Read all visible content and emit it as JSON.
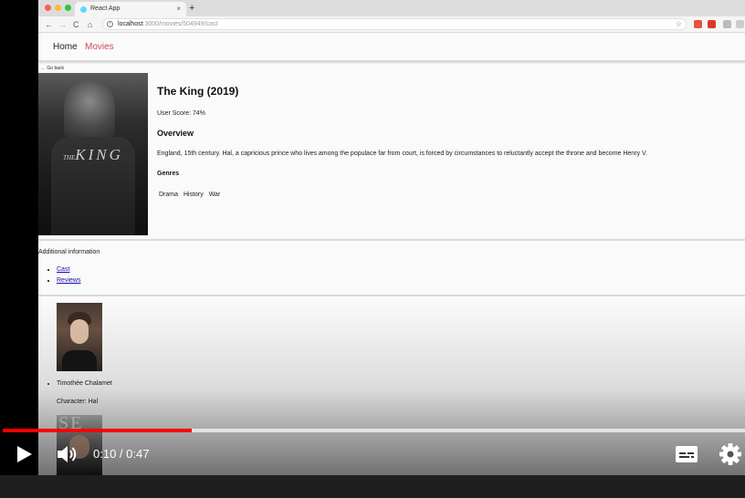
{
  "browser": {
    "tab_title": "React App",
    "tab_close": "×",
    "new_tab": "+",
    "url_host": "localhost",
    "url_path": ":3000/movies/504949/cast",
    "back": "←",
    "forward": "→",
    "reload": "C",
    "home": "⌂",
    "star": "☆",
    "info": "i"
  },
  "site_nav": {
    "home": "Home",
    "movies": "Movies"
  },
  "go_back": "← Go back",
  "movie": {
    "poster_the": "THE",
    "poster_title": "KING",
    "title": "The King (2019)",
    "user_score": "User Score: 74%",
    "overview_heading": "Overview",
    "overview_text": "England, 15th century. Hal, a capricious prince who lives among the populace far from court, is forced by circumstances to reluctantly accept the throne and become Henry V.",
    "genres_heading": "Genres",
    "genres": [
      "Drama",
      "History",
      "War"
    ]
  },
  "additional": {
    "heading": "Additional information",
    "links": [
      "Cast",
      "Reviews"
    ]
  },
  "cast": [
    {
      "name": "Timothée Chalamet",
      "character": "Character: Hal"
    }
  ],
  "cast_photo_2_text": "SE",
  "player": {
    "time": "0:10 / 0:47",
    "progress_played": 0.255,
    "progress_buffered": 1.0,
    "accent": "#ff0000"
  }
}
